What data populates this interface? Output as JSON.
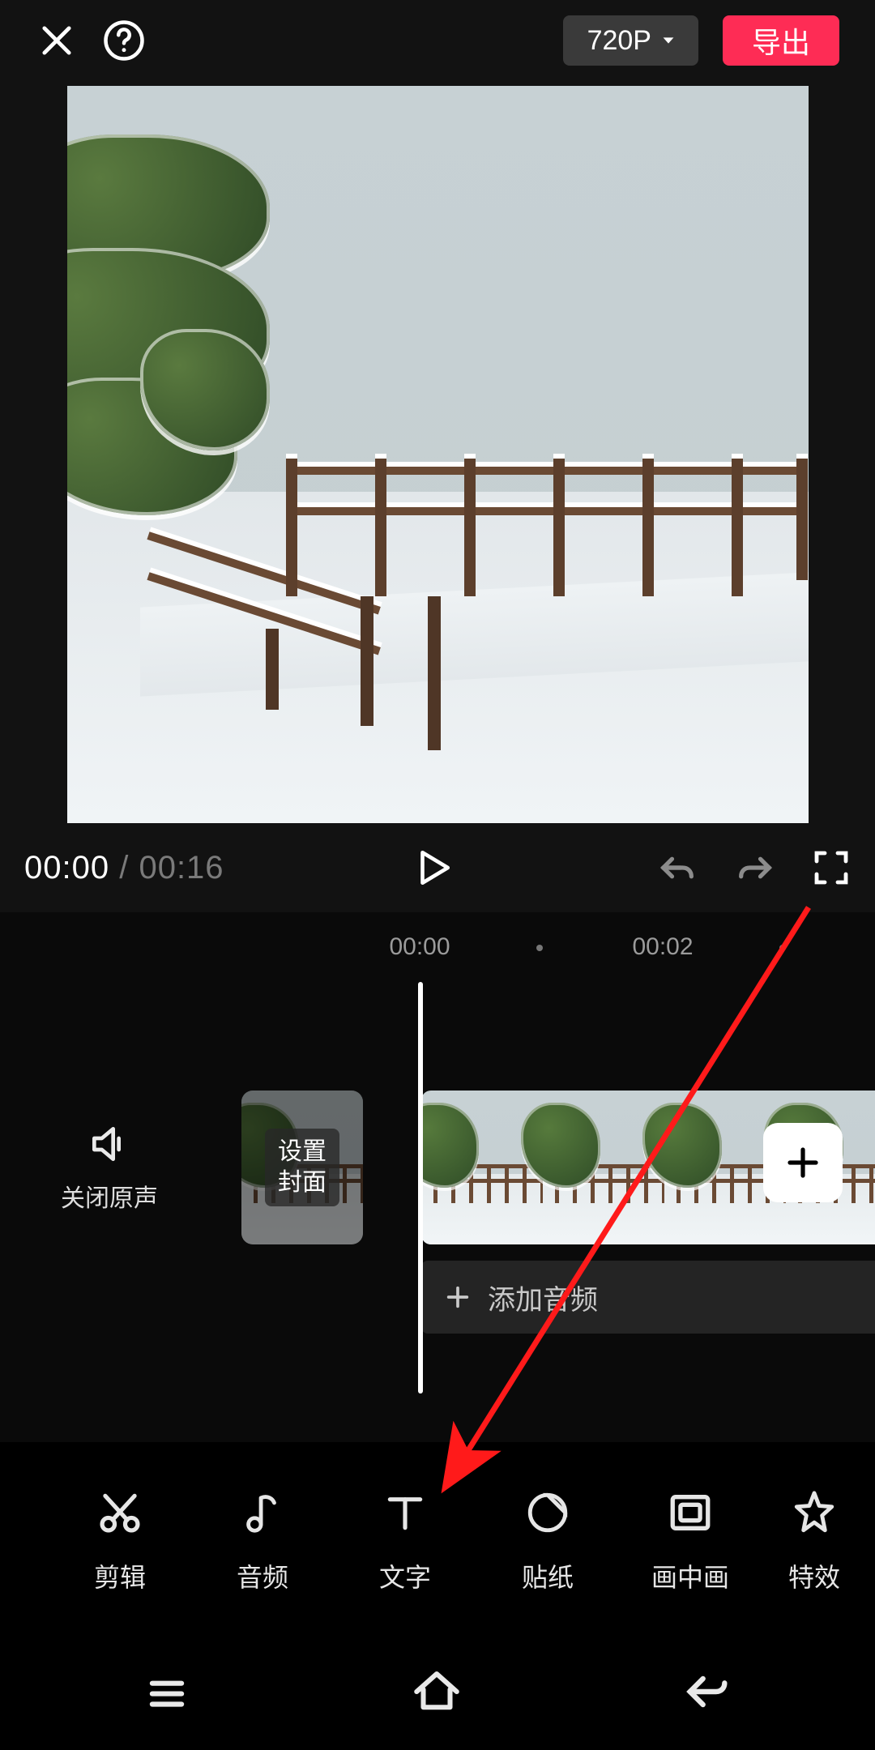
{
  "topbar": {
    "resolution_label": "720P",
    "export_label": "导出"
  },
  "playback": {
    "current_time": "00:00",
    "separator": " / ",
    "duration": "00:16"
  },
  "ruler": {
    "tick0": "00:00",
    "tick1": "00:02"
  },
  "track": {
    "mute_label": "关闭原声",
    "cover_line1": "设置",
    "cover_line2": "封面",
    "add_audio_label": "添加音频"
  },
  "toolbar": {
    "items": [
      {
        "label": "剪辑"
      },
      {
        "label": "音频"
      },
      {
        "label": "文字"
      },
      {
        "label": "贴纸"
      },
      {
        "label": "画中画"
      },
      {
        "label": "特效"
      }
    ]
  }
}
